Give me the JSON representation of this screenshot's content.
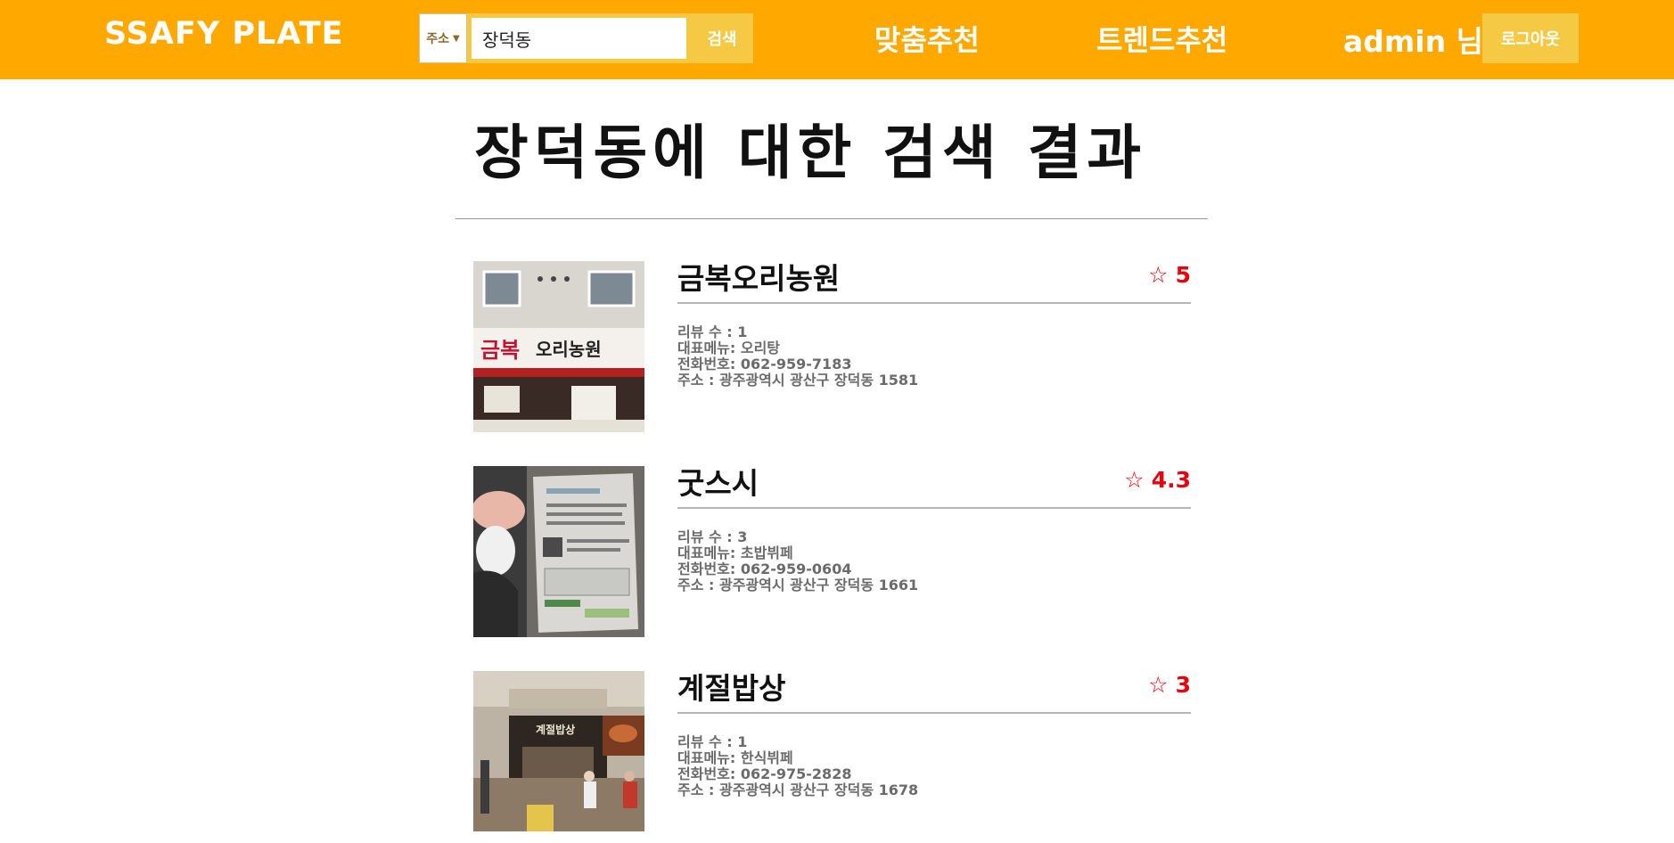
{
  "header": {
    "logo": "SSAFY PLATE",
    "search": {
      "select_value": "주소",
      "input_value": "장덕동",
      "button_label": "검색"
    },
    "nav": {
      "custom": "맞춤추천",
      "trend": "트렌드추천"
    },
    "user": "admin 님",
    "logout_label": "로그아웃"
  },
  "main": {
    "title": "장덕동에 대한 검색 결과",
    "results": [
      {
        "name": "금복오리농원",
        "rating": "5",
        "review_count": "리뷰 수 : 1",
        "menu": "대표메뉴: 오리탕",
        "phone": "전화번호: 062-959-7183",
        "address": "주소 : 광주광역시 광산구 장덕동 1581",
        "thumb_sign": "금복 오리농원"
      },
      {
        "name": "굿스시",
        "rating": "4.3",
        "review_count": "리뷰 수 : 3",
        "menu": "대표메뉴: 초밥뷔페",
        "phone": "전화번호: 062-959-0604",
        "address": "주소 : 광주광역시 광산구 장덕동 1661"
      },
      {
        "name": "계절밥상",
        "rating": "3",
        "review_count": "리뷰 수 : 1",
        "menu": "대표메뉴: 한식뷔페",
        "phone": "전화번호: 062-975-2828",
        "address": "주소 : 광주광역시 광산구 장덕동 1678",
        "thumb_sign": "계절밥상"
      }
    ]
  },
  "colors": {
    "header_bg": "#ffa800",
    "button_bg": "#f6c945",
    "rating": "#e8000a"
  },
  "icons": {
    "rating": "star-icon",
    "select": "caret-down-icon"
  }
}
